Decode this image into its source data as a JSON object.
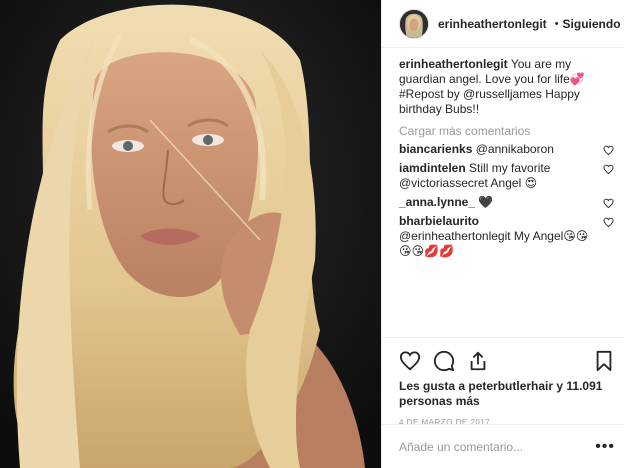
{
  "header": {
    "username": "erinheathertonlegit",
    "separator": "•",
    "follow_status": "Siguiendo"
  },
  "caption": {
    "username": "erinheathertonlegit",
    "text": "You are my guardian angel. Love you for life💞 #Repost by @russelljames Happy birthday Bubs!!"
  },
  "load_more": "Cargar más comentarios",
  "comments": [
    {
      "username": "biancarienks",
      "text": "@annikaboron"
    },
    {
      "username": "iamdintelen",
      "text": "Still my favorite @victoriassecret Angel 😍"
    },
    {
      "username": "_anna.lynne_",
      "text": "🖤"
    },
    {
      "username": "bharbielaurito",
      "text": "@erinheathertonlegit My Angel😘😘😘😘💋💋"
    }
  ],
  "likes": {
    "text": "Les gusta a peterbutlerhair y 11.091 personas más"
  },
  "date": "4 de marzo de 2017",
  "add_comment": {
    "placeholder": "Añade un comentario...",
    "more": "•••"
  },
  "icons": {
    "like": "heart-icon",
    "comment": "comment-bubble-icon",
    "share": "share-icon",
    "save": "bookmark-icon",
    "verified": "verified-badge-icon"
  },
  "colors": {
    "verified": "#3897f0",
    "photo_background": "#141414",
    "hair": "#e8d2a6"
  }
}
